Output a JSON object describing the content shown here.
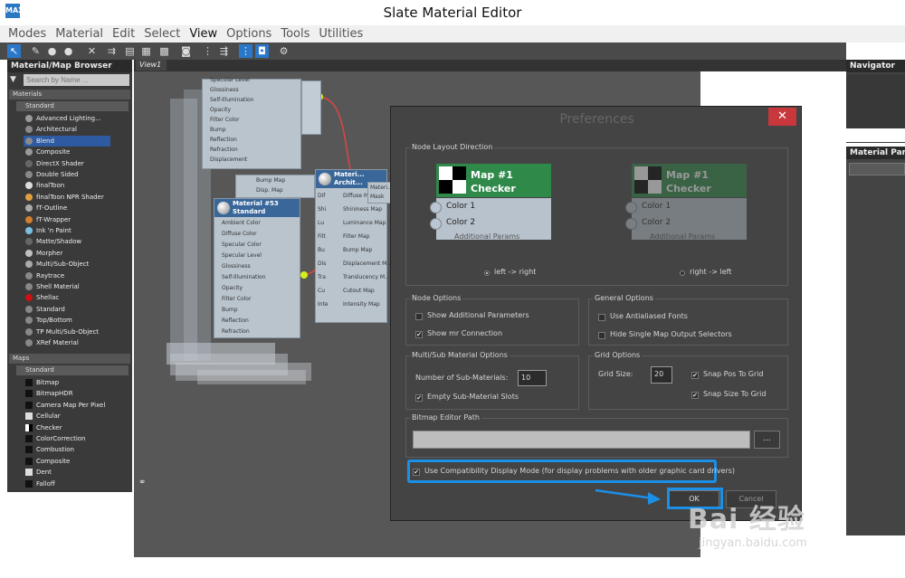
{
  "window": {
    "title": "Slate Material Editor",
    "logo_text": "MAX"
  },
  "menu": [
    {
      "label": "Modes",
      "bold": false
    },
    {
      "label": "Material",
      "bold": false
    },
    {
      "label": "Edit",
      "bold": false
    },
    {
      "label": "Select",
      "bold": false
    },
    {
      "label": "View",
      "bold": true
    },
    {
      "label": "Options",
      "bold": false
    },
    {
      "label": "Tools",
      "bold": false
    },
    {
      "label": "Utilities",
      "bold": false
    }
  ],
  "browser": {
    "title": "Material/Map Browser",
    "search_placeholder": "Search by Name ...",
    "materials_header": "Materials",
    "materials_sub": "Standard",
    "materials": [
      "Advanced Lighting...",
      "Architectural",
      "Blend",
      "Composite",
      "DirectX Shader",
      "Double Sided",
      "finalToon",
      "finalToon NPR Shader",
      "fT-Outline",
      "fT-Wrapper",
      "Ink 'n Paint",
      "Matte/Shadow",
      "Morpher",
      "Multi/Sub-Object",
      "Raytrace",
      "Shell Material",
      "Shellac",
      "Standard",
      "Top/Bottom",
      "TP Multi/Sub-Object",
      "XRef Material"
    ],
    "selected_material": "Blend",
    "maps_header": "Maps",
    "maps_sub": "Standard",
    "maps": [
      "Bitmap",
      "BitmapHDR",
      "Camera Map Per Pixel",
      "Cellular",
      "Checker",
      "ColorCorrection",
      "Combustion",
      "Composite",
      "Dent",
      "Falloff"
    ]
  },
  "view": {
    "tab": "View1"
  },
  "nodes": {
    "top_rows": [
      "Specular Level",
      "Glossiness",
      "Self-Illumination",
      "Opacity",
      "Filter Color",
      "Bump",
      "Reflection",
      "Refraction",
      "Displacement"
    ],
    "small_rows": [
      "Bump Map",
      "Disp. Map"
    ],
    "mat53_title": "Material #53",
    "mat53_sub": "Standard",
    "mat53_rows": [
      "Ambient Color",
      "Diffuse Color",
      "Specular Color",
      "Specular Level",
      "Glossiness",
      "Self-Illumination",
      "Opacity",
      "Filter Color",
      "Bump",
      "Reflection",
      "Refraction"
    ],
    "arch_title": "Materi...",
    "arch_sub": "Archit...",
    "arch_rows": [
      "Diffuse Map",
      "Shininess Map",
      "Luminance Map",
      "Filter Map",
      "Bump Map",
      "Displacement M...",
      "Translucency M...",
      "Cutout Map",
      "Intensity Map"
    ],
    "arch_left": [
      "Dif",
      "Shi",
      "Lu",
      "Filt",
      "Bu",
      "Dis",
      "Tra",
      "Cu",
      "Inte"
    ],
    "right_rows": [
      "Materi...",
      "Mask"
    ]
  },
  "navigator": {
    "title": "Navigator"
  },
  "material_params": {
    "title": "Material Parameter"
  },
  "dialog": {
    "title": "Preferences",
    "close": "✕",
    "node_layout": {
      "label": "Node Layout Direction",
      "preview_title_1": "Map #1",
      "preview_title_2": "Checker",
      "color1": "Color 1",
      "color2": "Color 2",
      "footer": "Additional Params",
      "left_to_right": "left -> right",
      "right_to_left": "right -> left",
      "selected": "left -> right"
    },
    "node_options": {
      "label": "Node Options",
      "show_additional": {
        "label": "Show Additional Parameters",
        "checked": false
      },
      "show_mr": {
        "label": "Show mr Connection",
        "checked": true
      }
    },
    "general_options": {
      "label": "General Options",
      "antialiased": {
        "label": "Use Antialiased Fonts",
        "checked": false
      },
      "hide_selectors": {
        "label": "Hide Single Map Output Selectors",
        "checked": false
      }
    },
    "multisub": {
      "label": "Multi/Sub Material Options",
      "num_label": "Number of Sub-Materials:",
      "num_value": "10",
      "empty_slots": {
        "label": "Empty Sub-Material Slots",
        "checked": true
      }
    },
    "grid": {
      "label": "Grid Options",
      "size_label": "Grid Size:",
      "size_value": "20",
      "snap_pos": {
        "label": "Snap Pos To Grid",
        "checked": true
      },
      "snap_size": {
        "label": "Snap Size To Grid",
        "checked": true
      }
    },
    "bitmap": {
      "label": "Bitmap Editor Path",
      "value": "",
      "browse": "..."
    },
    "compat": {
      "label": "Use Compatibility Display Mode (for display problems with older graphic card drivers)",
      "checked": true
    },
    "ok": "OK",
    "cancel": "Cancel"
  },
  "watermark": {
    "logo": "Bai 经验",
    "url": "jingyan.baidu.com"
  },
  "colors": {
    "highlight": "#1c8fe6",
    "node_header": "#2f8a4a",
    "close_button": "#c8373b",
    "selection": "#2d5aa0"
  }
}
